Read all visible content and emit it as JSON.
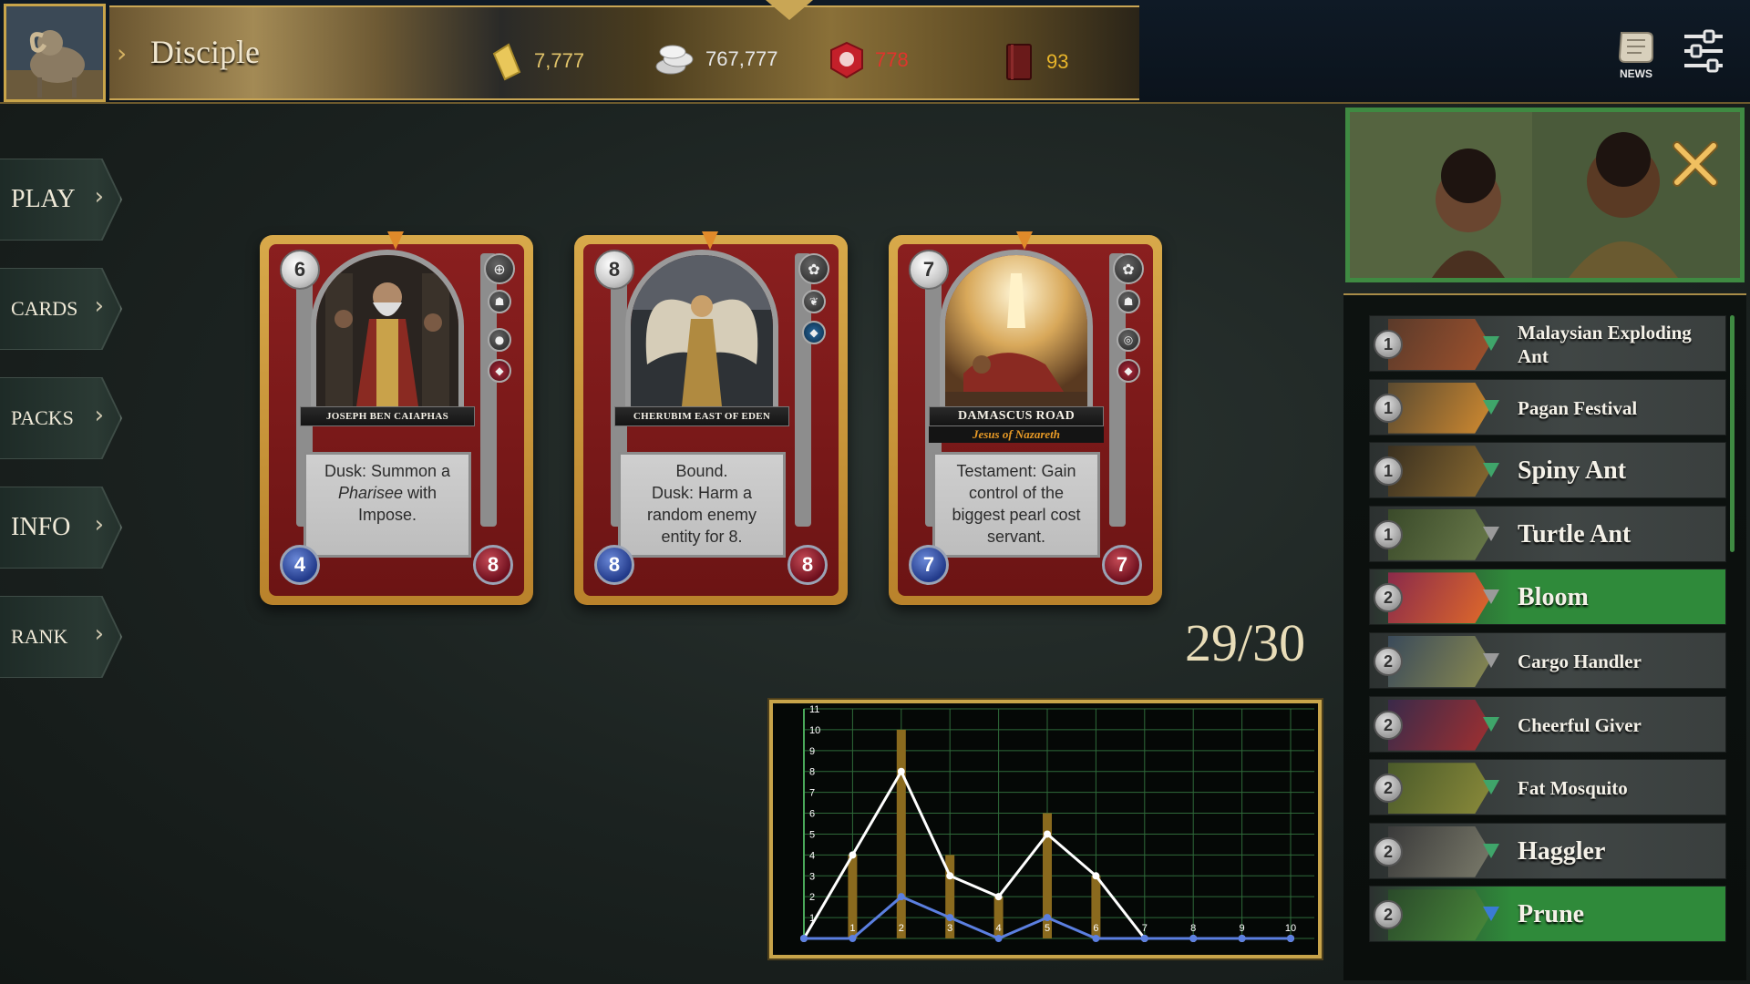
{
  "player": {
    "rank_title": "Disciple"
  },
  "resources": [
    {
      "icon": "gold-bar-icon",
      "value": "7,777",
      "color": "#e2c46a"
    },
    {
      "icon": "silver-coins-icon",
      "value": "767,777",
      "color": "#e6e6e6"
    },
    {
      "icon": "red-badge-icon",
      "value": "778",
      "color": "#e0342c"
    },
    {
      "icon": "book-icon",
      "value": "93",
      "color": "#e8b52a"
    }
  ],
  "header": {
    "news_label": "NEWS"
  },
  "nav": [
    {
      "label": "PLAY"
    },
    {
      "label": "CARDS"
    },
    {
      "label": "PACKS"
    },
    {
      "label": "INFO"
    },
    {
      "label": "RANK"
    }
  ],
  "cards": [
    {
      "cost": "6",
      "name": "JOSEPH BEN CAIAPHAS",
      "subtitle": "",
      "text_html": "Dusk: Summon a <i>Pharisee</i> with Impose.",
      "attack": "4",
      "health": "8"
    },
    {
      "cost": "8",
      "name": "CHERUBIM EAST OF EDEN",
      "subtitle": "",
      "text_html": "Bound.<br>Dusk: Harm a random enemy entity for 8.",
      "attack": "8",
      "health": "8"
    },
    {
      "cost": "7",
      "name": "DAMASCUS ROAD",
      "subtitle": "Jesus of Nazareth",
      "text_html": "Testament: Gain control of the biggest pearl cost servant.",
      "attack": "7",
      "health": "7"
    }
  ],
  "deck": {
    "count_text": "29/30",
    "cards": [
      {
        "cost": "1",
        "name": "Malaysian Exploding Ant",
        "highlighted": false,
        "gem_color": "#3fa56a"
      },
      {
        "cost": "1",
        "name": "Pagan Festival",
        "highlighted": false,
        "gem_color": "#3fa56a"
      },
      {
        "cost": "1",
        "name": "Spiny Ant",
        "highlighted": false,
        "gem_color": "#3fa56a"
      },
      {
        "cost": "1",
        "name": "Turtle Ant",
        "highlighted": false,
        "gem_color": "#9a9a9a"
      },
      {
        "cost": "2",
        "name": "Bloom",
        "highlighted": true,
        "gem_color": "#9a9a9a"
      },
      {
        "cost": "2",
        "name": "Cargo Handler",
        "highlighted": false,
        "gem_color": "#9a9a9a"
      },
      {
        "cost": "2",
        "name": "Cheerful Giver",
        "highlighted": false,
        "gem_color": "#3fa56a"
      },
      {
        "cost": "2",
        "name": "Fat Mosquito",
        "highlighted": false,
        "gem_color": "#3fa56a"
      },
      {
        "cost": "2",
        "name": "Haggler",
        "highlighted": false,
        "gem_color": "#3fa56a"
      },
      {
        "cost": "2",
        "name": "Prune",
        "highlighted": true,
        "gem_color": "#3a7bd5"
      }
    ]
  },
  "chart_data": {
    "type": "bar",
    "title": "",
    "xlabel": "",
    "ylabel": "",
    "x": [
      0,
      1,
      2,
      3,
      4,
      5,
      6,
      7,
      8,
      9,
      10
    ],
    "x_tick_labels": [
      "1",
      "2",
      "3",
      "4",
      "5",
      "6",
      "7",
      "8",
      "9",
      "10"
    ],
    "y_tick_labels": [
      "1",
      "2",
      "3",
      "4",
      "5",
      "6",
      "7",
      "8",
      "9",
      "10",
      "11"
    ],
    "ylim": [
      0,
      11
    ],
    "grid": true,
    "series": [
      {
        "kind": "bar",
        "color": "#8a6a1e",
        "values": [
          0,
          4,
          10,
          4,
          2,
          6,
          3,
          0,
          0,
          0,
          0
        ]
      },
      {
        "kind": "line",
        "color": "#ffffff",
        "values": [
          0,
          4,
          8,
          3,
          2,
          5,
          3,
          0,
          0,
          0,
          0
        ]
      },
      {
        "kind": "line",
        "color": "#5b7fe0",
        "values": [
          0,
          0,
          2,
          1,
          0,
          1,
          0,
          0,
          0,
          0,
          0
        ]
      }
    ]
  }
}
